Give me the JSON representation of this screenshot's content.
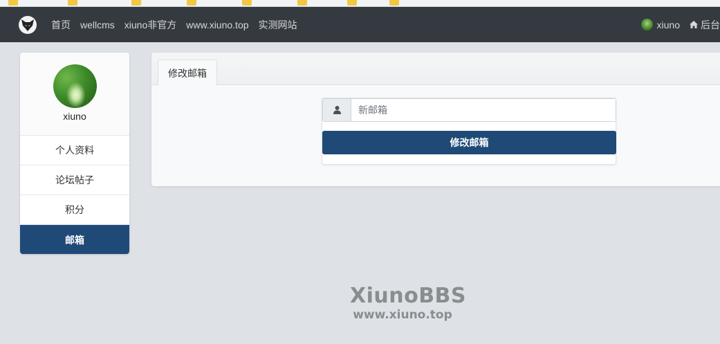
{
  "navbar": {
    "links": [
      "首页",
      "wellcms",
      "xiuno非官方",
      "www.xiuno.top",
      "实测网站"
    ],
    "user_name": "xiuno",
    "admin_label": "后台"
  },
  "user_card": {
    "username": "xiuno",
    "menu": [
      {
        "label": "个人资料",
        "active": false
      },
      {
        "label": "论坛帖子",
        "active": false
      },
      {
        "label": "积分",
        "active": false
      },
      {
        "label": "邮箱",
        "active": true
      }
    ]
  },
  "main": {
    "tab_label": "修改邮箱",
    "email_placeholder": "新邮箱",
    "email_value": "",
    "submit_label": "修改邮箱"
  },
  "watermark": {
    "title": "XiunoBBS",
    "url": "www.xiuno.top"
  },
  "colors": {
    "navbar_bg": "#343a40",
    "accent": "#1f4a78",
    "page_bg": "#dee1e5"
  },
  "icons": {
    "logo": "wolf-logo-icon",
    "home": "home-icon",
    "user": "user-icon"
  }
}
